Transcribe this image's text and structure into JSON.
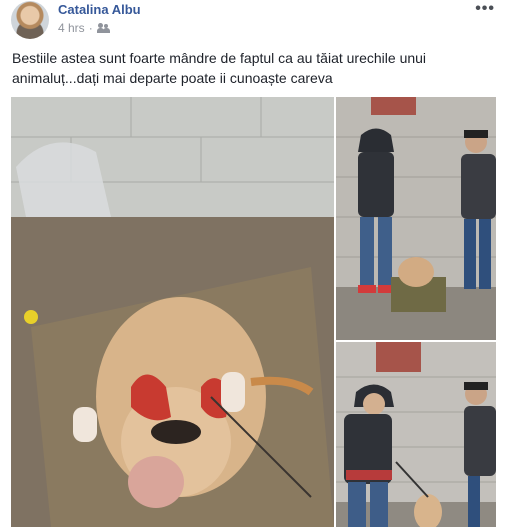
{
  "post": {
    "author": "Catalina Albu",
    "time": "4 hrs",
    "audience_icon": "friends-icon",
    "options_icon": "more-options-icon",
    "options_glyph": "•••",
    "separator": "·",
    "text": "Bestiile astea sunt foarte mândre de faptul ca au tăiat urechile unui animaluț...dați mai departe poate ii cunoaște careva"
  }
}
